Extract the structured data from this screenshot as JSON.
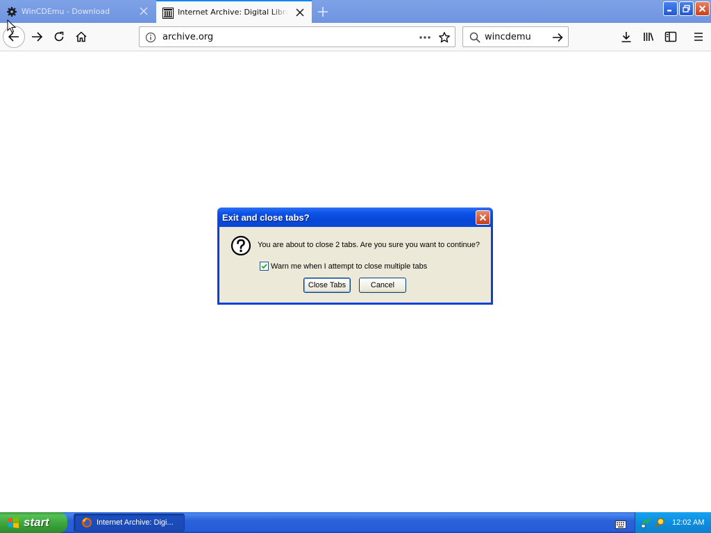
{
  "browser": {
    "tabs": [
      {
        "title": "WinCDEmu - Download",
        "favicon": "gear-icon",
        "active": false
      },
      {
        "title": "Internet Archive: Digital Library of",
        "favicon": "archive-building-icon",
        "active": true
      }
    ],
    "url": "archive.org",
    "search_query": "wincdemu"
  },
  "dialog": {
    "title": "Exit and close tabs?",
    "message": "You are about to close 2 tabs. Are you sure you want to continue?",
    "checkbox_label": "Warn me when I attempt to close multiple tabs",
    "checkbox_checked": true,
    "confirm_label": "Close Tabs",
    "cancel_label": "Cancel"
  },
  "taskbar": {
    "start_label": "start",
    "task_label": "Internet Archive: Digi...",
    "clock": "12:02 AM"
  },
  "colors": {
    "accent": "#0a84ff",
    "xp_blue": "#245ddb",
    "start_green": "#39a339"
  }
}
